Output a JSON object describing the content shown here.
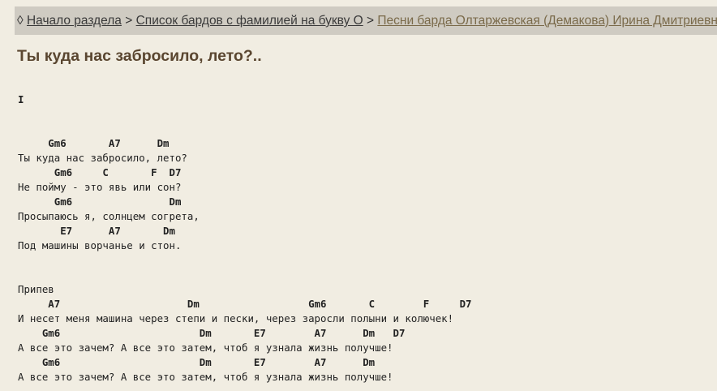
{
  "breadcrumb": {
    "marker": "◊",
    "items": [
      {
        "label": "Начало раздела"
      },
      {
        "label": "Список бардов с фамилией на букву О"
      },
      {
        "label": "Песни барда Олтаржевская (Демакова) Ирина Дмитриевна"
      }
    ],
    "separator": ">"
  },
  "song": {
    "title": "Ты куда нас забросило, лето?..",
    "lines": [
      {
        "type": "section",
        "text": "I"
      },
      {
        "type": "blank",
        "text": ""
      },
      {
        "type": "blank",
        "text": ""
      },
      {
        "type": "chord",
        "text": "     Gm6       A7      Dm"
      },
      {
        "type": "lyric",
        "text": "Ты куда нас забросило, лето?"
      },
      {
        "type": "chord",
        "text": "      Gm6     C       F  D7"
      },
      {
        "type": "lyric",
        "text": "Не пойму - это явь или сон?"
      },
      {
        "type": "chord",
        "text": "      Gm6                Dm"
      },
      {
        "type": "lyric",
        "text": "Просыпаюсь я, солнцем согрета,"
      },
      {
        "type": "chord",
        "text": "       E7      A7       Dm"
      },
      {
        "type": "lyric",
        "text": "Под машины ворчанье и стон."
      },
      {
        "type": "blank",
        "text": ""
      },
      {
        "type": "blank",
        "text": ""
      },
      {
        "type": "lyric",
        "text": "Припев"
      },
      {
        "type": "chord",
        "text": "     A7                     Dm                  Gm6       C        F     D7"
      },
      {
        "type": "lyric",
        "text": "И несет меня машина через степи и пески, через заросли полыни и колючек!"
      },
      {
        "type": "chord",
        "text": "    Gm6                       Dm       E7        A7      Dm   D7"
      },
      {
        "type": "lyric",
        "text": "А все это зачем? А все это затем, чтоб я узнала жизнь получше!"
      },
      {
        "type": "chord",
        "text": "    Gm6                       Dm       E7        A7      Dm"
      },
      {
        "type": "lyric",
        "text": "А все это зачем? А все это затем, чтоб я узнала жизнь получше!"
      }
    ]
  }
}
